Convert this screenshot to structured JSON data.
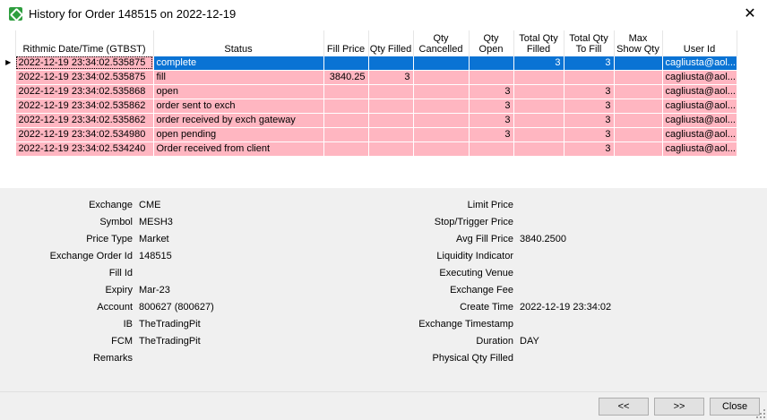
{
  "window": {
    "title": "History for Order 148515 on 2022-12-19"
  },
  "grid": {
    "columns": [
      "Rithmic Date/Time (GTBST)",
      "Status",
      "Fill Price",
      "Qty Filled",
      "Qty Cancelled",
      "Qty Open",
      "Total Qty Filled",
      "Total Qty To Fill",
      "Max Show Qty",
      "User Id"
    ],
    "rows": [
      {
        "datetime": "2022-12-19 23:34:02.535875",
        "status": "complete",
        "fill_price": "",
        "qty_filled": "",
        "qty_cancelled": "",
        "qty_open": "",
        "total_qty_filled": "3",
        "total_qty_to_fill": "3",
        "max_show_qty": "",
        "user_id": "cagliusta@aol...",
        "selected": true
      },
      {
        "datetime": "2022-12-19 23:34:02.535875",
        "status": "fill",
        "fill_price": "3840.25",
        "qty_filled": "3",
        "qty_cancelled": "",
        "qty_open": "",
        "total_qty_filled": "",
        "total_qty_to_fill": "",
        "max_show_qty": "",
        "user_id": "cagliusta@aol...",
        "selected": false
      },
      {
        "datetime": "2022-12-19 23:34:02.535868",
        "status": "open",
        "fill_price": "",
        "qty_filled": "",
        "qty_cancelled": "",
        "qty_open": "3",
        "total_qty_filled": "",
        "total_qty_to_fill": "3",
        "max_show_qty": "",
        "user_id": "cagliusta@aol...",
        "selected": false
      },
      {
        "datetime": "2022-12-19 23:34:02.535862",
        "status": "order sent to exch",
        "fill_price": "",
        "qty_filled": "",
        "qty_cancelled": "",
        "qty_open": "3",
        "total_qty_filled": "",
        "total_qty_to_fill": "3",
        "max_show_qty": "",
        "user_id": "cagliusta@aol...",
        "selected": false
      },
      {
        "datetime": "2022-12-19 23:34:02.535862",
        "status": "order received by exch gateway",
        "fill_price": "",
        "qty_filled": "",
        "qty_cancelled": "",
        "qty_open": "3",
        "total_qty_filled": "",
        "total_qty_to_fill": "3",
        "max_show_qty": "",
        "user_id": "cagliusta@aol...",
        "selected": false
      },
      {
        "datetime": "2022-12-19 23:34:02.534980",
        "status": "open pending",
        "fill_price": "",
        "qty_filled": "",
        "qty_cancelled": "",
        "qty_open": "3",
        "total_qty_filled": "",
        "total_qty_to_fill": "3",
        "max_show_qty": "",
        "user_id": "cagliusta@aol...",
        "selected": false
      },
      {
        "datetime": "2022-12-19 23:34:02.534240",
        "status": "Order received from client",
        "fill_price": "",
        "qty_filled": "",
        "qty_cancelled": "",
        "qty_open": "",
        "total_qty_filled": "",
        "total_qty_to_fill": "3",
        "max_show_qty": "",
        "user_id": "cagliusta@aol...",
        "selected": false
      }
    ]
  },
  "details": {
    "left": [
      {
        "label": "Exchange",
        "value": "CME"
      },
      {
        "label": "Symbol",
        "value": "MESH3"
      },
      {
        "label": "Price Type",
        "value": "Market"
      },
      {
        "label": "Exchange Order Id",
        "value": "148515"
      },
      {
        "label": "Fill Id",
        "value": ""
      },
      {
        "label": "Expiry",
        "value": "Mar-23"
      },
      {
        "label": "Account",
        "value": "800627 (800627)"
      },
      {
        "label": "IB",
        "value": "TheTradingPit"
      },
      {
        "label": "FCM",
        "value": "TheTradingPit"
      },
      {
        "label": "Remarks",
        "value": ""
      }
    ],
    "right": [
      {
        "label": "Limit Price",
        "value": ""
      },
      {
        "label": "Stop/Trigger Price",
        "value": ""
      },
      {
        "label": "Avg Fill Price",
        "value": "3840.2500"
      },
      {
        "label": "Liquidity Indicator",
        "value": ""
      },
      {
        "label": "Executing Venue",
        "value": ""
      },
      {
        "label": "Exchange Fee",
        "value": ""
      },
      {
        "label": "Create Time",
        "value": "2022-12-19 23:34:02"
      },
      {
        "label": "Exchange Timestamp",
        "value": ""
      },
      {
        "label": "Duration",
        "value": "DAY"
      },
      {
        "label": "Physical Qty Filled",
        "value": ""
      }
    ]
  },
  "buttons": {
    "prev": "<<",
    "next": ">>",
    "close": "Close"
  },
  "colors": {
    "row_background": "#ffb6c1",
    "selected_row": "#0a73d4",
    "app_icon": "#2e9e3e"
  }
}
